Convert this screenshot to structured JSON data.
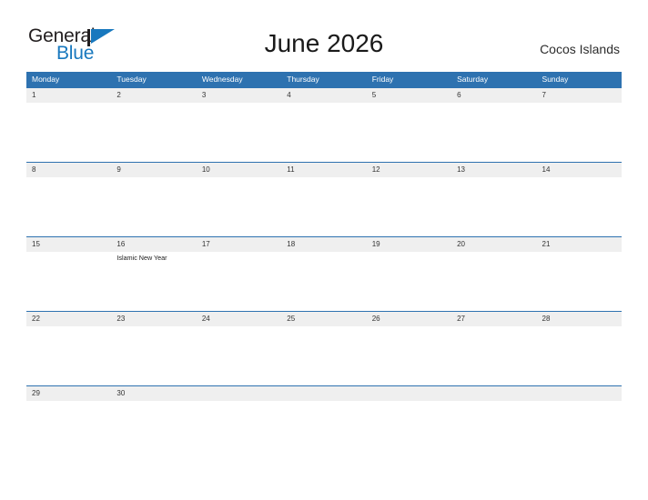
{
  "logo": {
    "word_one": "General",
    "word_two": "Blue",
    "flag_icon": "blue-flag-triangle-icon",
    "word_one_color": "#231f20",
    "word_two_color": "#1878be"
  },
  "header": {
    "title": "June 2026",
    "region": "Cocos Islands"
  },
  "theme": {
    "header_blue": "#2e72b0",
    "date_strip_gray": "#efefef",
    "cell_white": "#ffffff",
    "text_dark": "#333333"
  },
  "calendar": {
    "weekdays": [
      "Monday",
      "Tuesday",
      "Wednesday",
      "Thursday",
      "Friday",
      "Saturday",
      "Sunday"
    ],
    "weeks": [
      {
        "dates": [
          "1",
          "2",
          "3",
          "4",
          "5",
          "6",
          "7"
        ],
        "events": [
          "",
          "",
          "",
          "",
          "",
          "",
          ""
        ]
      },
      {
        "dates": [
          "8",
          "9",
          "10",
          "11",
          "12",
          "13",
          "14"
        ],
        "events": [
          "",
          "",
          "",
          "",
          "",
          "",
          ""
        ]
      },
      {
        "dates": [
          "15",
          "16",
          "17",
          "18",
          "19",
          "20",
          "21"
        ],
        "events": [
          "",
          "Islamic New Year",
          "",
          "",
          "",
          "",
          ""
        ]
      },
      {
        "dates": [
          "22",
          "23",
          "24",
          "25",
          "26",
          "27",
          "28"
        ],
        "events": [
          "",
          "",
          "",
          "",
          "",
          "",
          ""
        ]
      },
      {
        "dates": [
          "29",
          "30",
          "",
          "",
          "",
          "",
          ""
        ],
        "events": [
          "",
          "",
          "",
          "",
          "",
          "",
          ""
        ]
      }
    ]
  }
}
